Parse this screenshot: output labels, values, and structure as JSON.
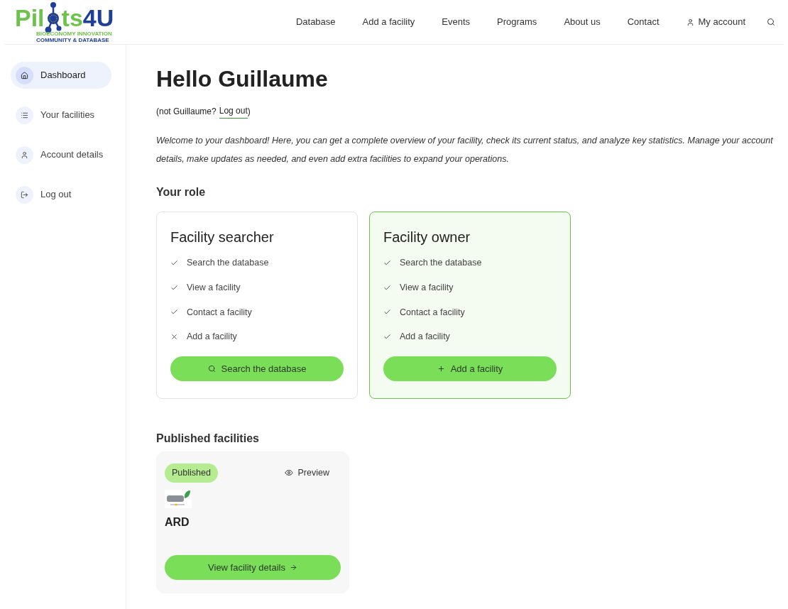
{
  "logo": {
    "text_before": "Pil",
    "text_after": "ts4U",
    "tagline": [
      "BIOECONOMY INNOVATION",
      "COMMUNITY & DATABASE"
    ]
  },
  "nav": [
    {
      "label": "Database",
      "kind": "link"
    },
    {
      "label": "Add a facility",
      "kind": "link"
    },
    {
      "label": "Events",
      "kind": "link"
    },
    {
      "label": "Programs",
      "kind": "link"
    },
    {
      "label": "About us",
      "kind": "link"
    },
    {
      "label": "Contact",
      "kind": "link"
    },
    {
      "label": "My account",
      "kind": "account"
    }
  ],
  "sidebar": {
    "items": [
      {
        "label": "Dashboard",
        "kind": "home",
        "selected": true
      },
      {
        "label": "Your facilities",
        "kind": "list",
        "selected": false
      },
      {
        "label": "Account details",
        "kind": "account",
        "selected": false
      },
      {
        "label": "Log out",
        "kind": "logout",
        "selected": false
      }
    ]
  },
  "greeting": "Hello Guillaume",
  "logout_prefix": "(not Guillaume?",
  "logout_link": "Log out",
  "logout_suffix": ")",
  "intro": "Welcome to your dashboard! Here, you can get a complete overview of your facility, check its current status, and analyze key statistics. Manage your account details, make updates as needed, and even add extra facilities to expand your operations.",
  "role_heading": "Your role",
  "roles": [
    {
      "title": "Facility searcher",
      "selected": false,
      "features": [
        {
          "label": "Search the database",
          "allowed": true
        },
        {
          "label": "View a facility",
          "allowed": true
        },
        {
          "label": "Contact a facility",
          "allowed": true
        },
        {
          "label": "Add a facility",
          "allowed": false
        }
      ],
      "button": {
        "label": "Search the database",
        "kind": "search"
      }
    },
    {
      "title": "Facility owner",
      "selected": true,
      "features": [
        {
          "label": "Search the database",
          "allowed": true
        },
        {
          "label": "View a facility",
          "allowed": true
        },
        {
          "label": "Contact a facility",
          "allowed": true
        },
        {
          "label": "Add a facility",
          "allowed": true
        }
      ],
      "button": {
        "label": "Add a facility",
        "kind": "add"
      }
    }
  ],
  "published_heading": "Published facilities",
  "facilities": [
    {
      "status": "Published",
      "preview": "Preview",
      "name": "ARD",
      "details_button": "View facility details"
    }
  ]
}
